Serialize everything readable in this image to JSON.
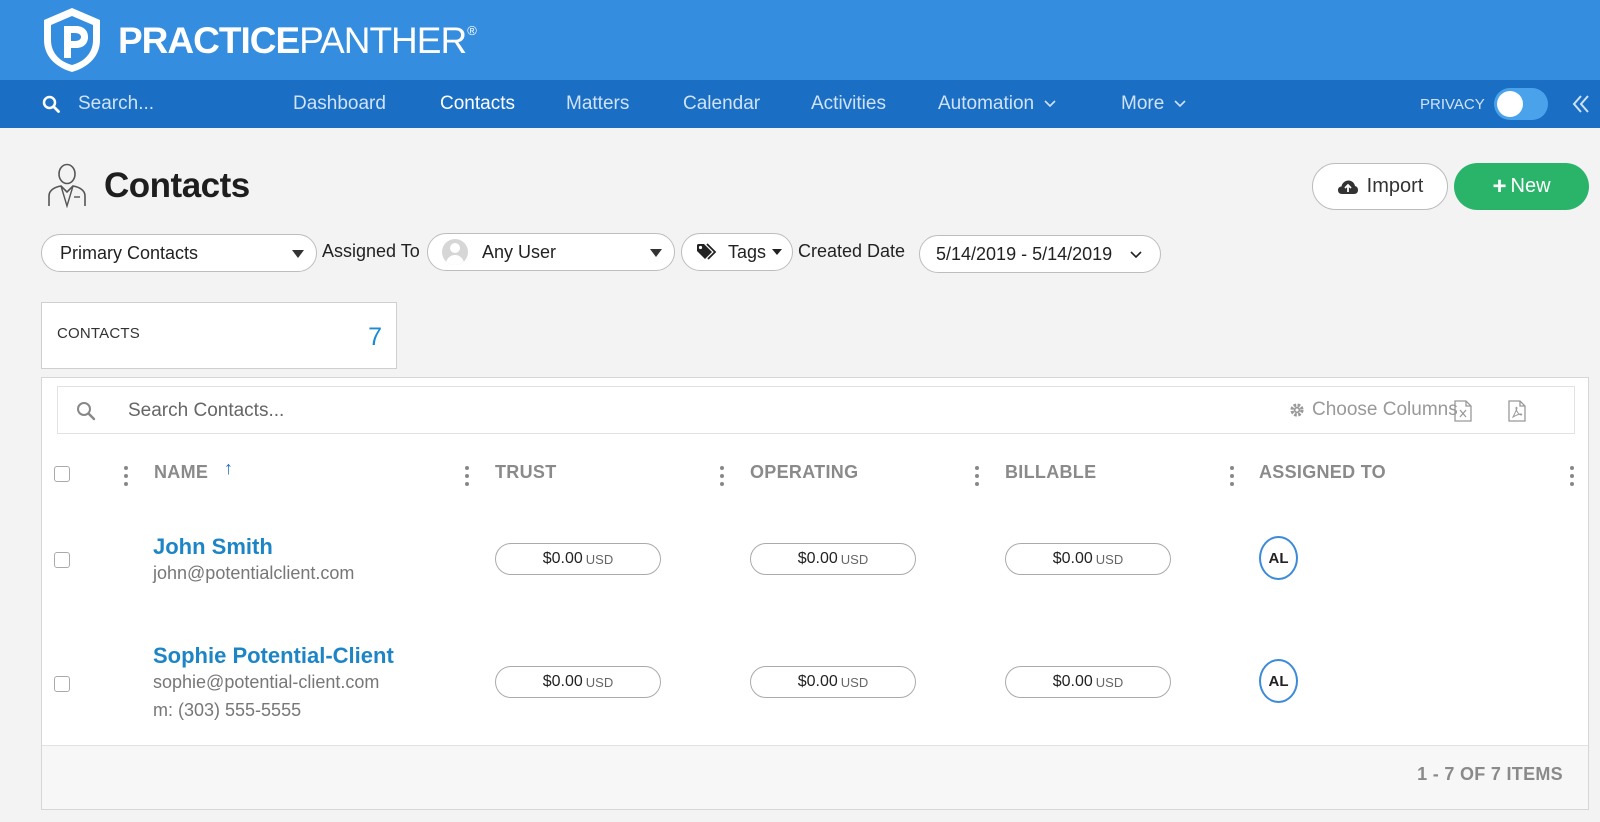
{
  "brand": {
    "name_bold": "PRACTICE",
    "name_light": "PANTHER",
    "mark": "®"
  },
  "nav": {
    "search_placeholder": "Search...",
    "items": [
      {
        "label": "Dashboard"
      },
      {
        "label": "Contacts"
      },
      {
        "label": "Matters"
      },
      {
        "label": "Calendar"
      },
      {
        "label": "Activities"
      },
      {
        "label": "Automation"
      },
      {
        "label": "More"
      }
    ],
    "active": "Contacts",
    "privacy_label": "PRIVACY",
    "privacy_on": false
  },
  "header": {
    "title": "Contacts",
    "import_label": "Import",
    "new_label": "New"
  },
  "filters": {
    "contact_type": "Primary Contacts",
    "assigned_label": "Assigned To",
    "assigned_value": "Any User",
    "tags_label": "Tags",
    "created_label": "Created Date",
    "date_range": "5/14/2019 - 5/14/2019"
  },
  "stats": {
    "label": "CONTACTS",
    "count": "7"
  },
  "table": {
    "search_placeholder": "Search Contacts...",
    "choose_columns": "Choose Columns",
    "columns": [
      "NAME",
      "TRUST",
      "OPERATING",
      "BILLABLE",
      "ASSIGNED TO"
    ],
    "sort_arrow": "↑",
    "rows": [
      {
        "name": "John Smith",
        "email": "john@potentialclient.com",
        "phone": "",
        "trust": "$0.00",
        "operating": "$0.00",
        "billable": "$0.00",
        "currency": "USD",
        "assigned": "AL"
      },
      {
        "name": "Sophie Potential-Client",
        "email": "sophie@potential-client.com",
        "phone": "m: (303) 555-5555",
        "trust": "$0.00",
        "operating": "$0.00",
        "billable": "$0.00",
        "currency": "USD",
        "assigned": "AL"
      }
    ],
    "pager": "1 - 7 OF 7 ITEMS"
  },
  "colors": {
    "brand": "#358de0",
    "nav": "#1a6ec3",
    "new_button": "#2ab46a",
    "link": "#1d85c6"
  }
}
